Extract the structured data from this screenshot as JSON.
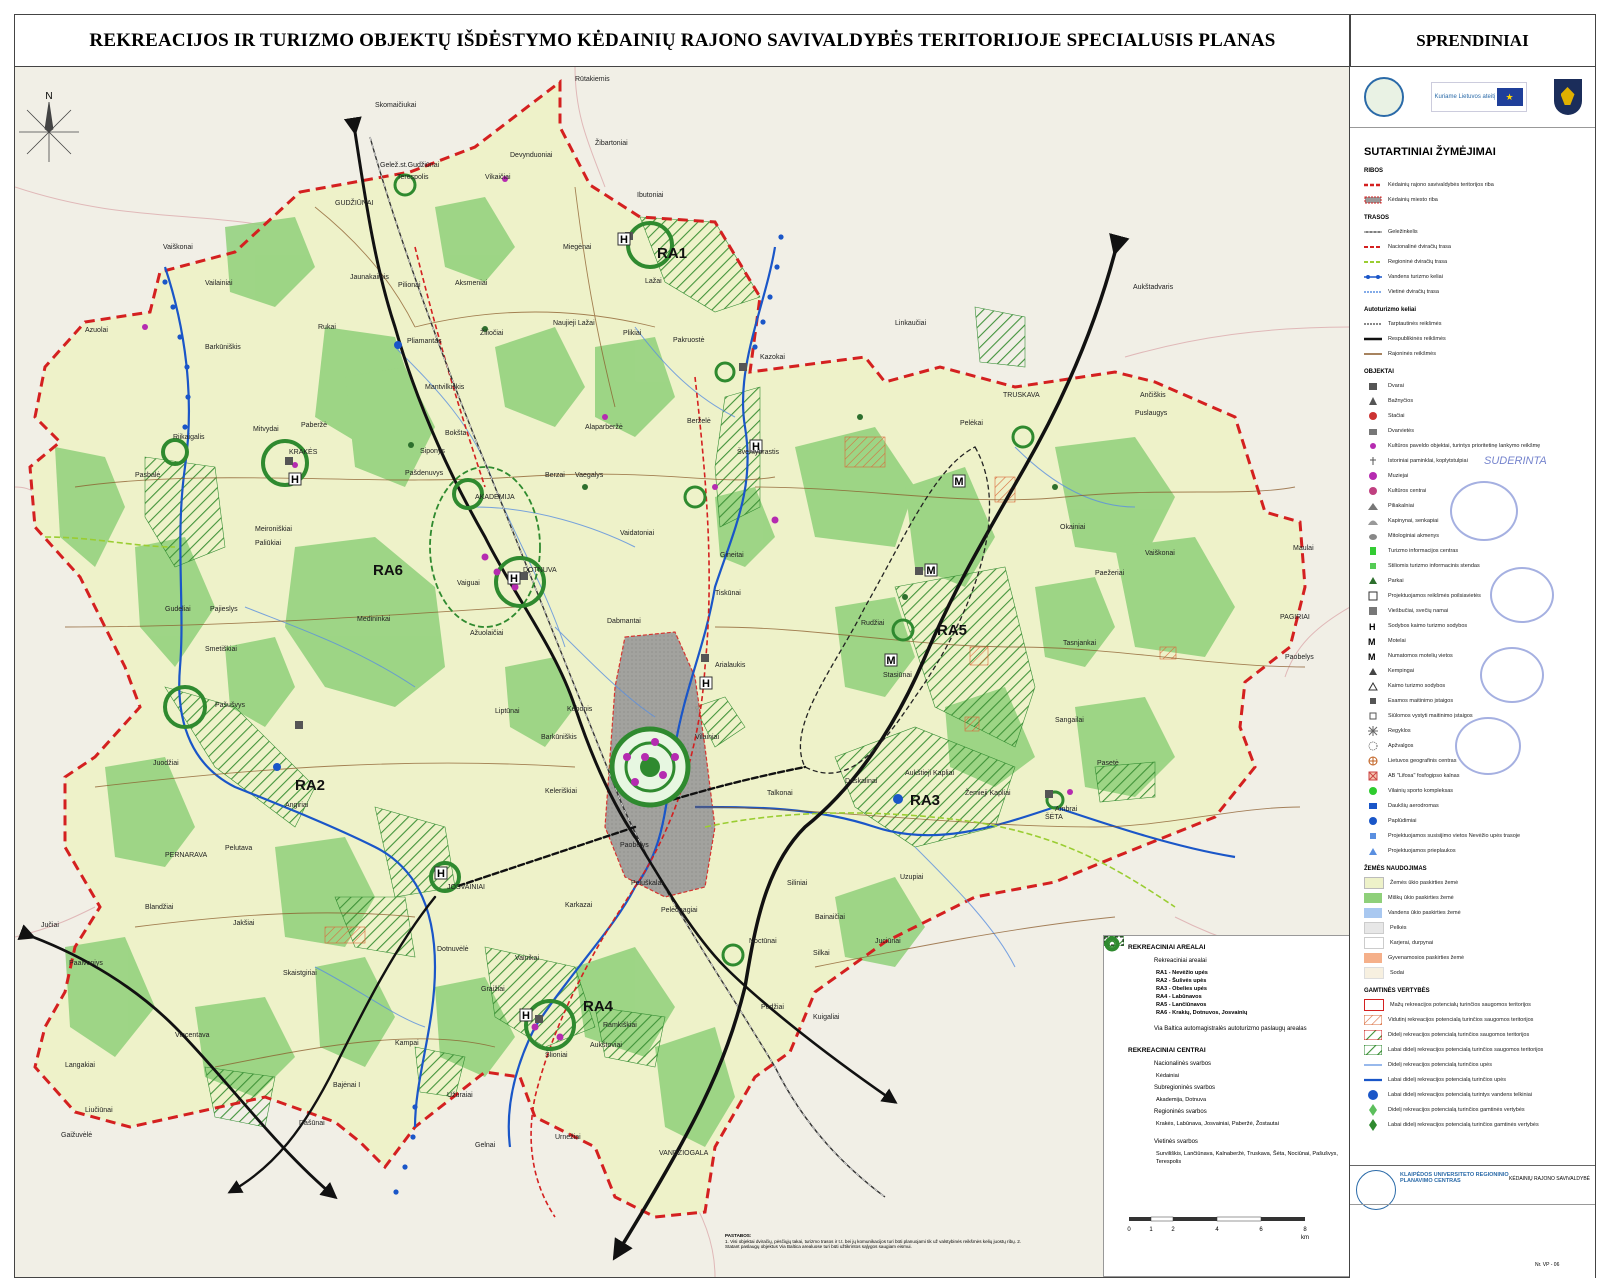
{
  "title": "REKREACIJOS IR TURIZMO OBJEKTŲ IŠDĖSTYMO KĖDAINIŲ RAJONO SAVIVALDYBĖS TERITORIJOJE SPECIALUSIS PLANAS",
  "section_title": "SPRENDINIAI",
  "north_label": "N",
  "area_labels": [
    {
      "id": "RA1",
      "label": "RA1"
    },
    {
      "id": "RA2",
      "label": "RA2"
    },
    {
      "id": "RA3",
      "label": "RA3"
    },
    {
      "id": "RA4",
      "label": "RA4"
    },
    {
      "id": "RA5",
      "label": "RA5"
    },
    {
      "id": "RA6",
      "label": "RA6"
    }
  ],
  "places": [
    "Rūtakiemis",
    "Skomaičiukai",
    "Žibartoniai",
    "Gelež.st.Gudžiūnai",
    "Terespolis",
    "Devynduoniai",
    "Vikaičiai",
    "GUDŽIŪNAI",
    "Ibutoniai",
    "Miegėnai",
    "Vaiškonai",
    "Vailainiai",
    "Jaunakaimis",
    "Pilionai",
    "Aksmeniai",
    "Lažai",
    "Aukštadvaris",
    "Rukai",
    "Žiliočiai",
    "Naujieji Lažai",
    "Plikiai",
    "Linkaučiai",
    "Azuolai",
    "Pliamantas",
    "Barkūniškis",
    "Pakruostė",
    "Kazokai",
    "Mantvilkiškis",
    "Ančiškis",
    "Pelėkai",
    "TRUSKAVA",
    "Riikaigalis",
    "Mitvydai",
    "Paberžė",
    "Bokšta",
    "Alaparberžė",
    "Berželė",
    "Šventybrastis",
    "Puslaugys",
    "Pasbalė",
    "KRAKĖS",
    "Siponys",
    "Pašdenuvys",
    "Berzai",
    "Vaegalys",
    "AKADEMIJA",
    "Meironiškiai",
    "Paliūkiai",
    "Vaidatoniai",
    "Gineitai",
    "Okainiai",
    "Vaiškonai",
    "DOTNUVA",
    "Vaiguai",
    "Maulai",
    "RA6",
    "Gudeliai",
    "Pajieslys",
    "Medininkai",
    "Rudžiai",
    "Paežeriai",
    "PAGIRIAI",
    "Paobelys",
    "Tiskūnai",
    "Smetiškiai",
    "Ažuolaičiai",
    "Dabmantai",
    "Tasnjankai",
    "Arialaukis",
    "Pašušvys",
    "Stasiūnai",
    "Liptūnai",
    "Kebonis",
    "Barkūniškis",
    "Vilainiai",
    "Sangailai",
    "Juodžiai",
    "Daskalinai",
    "Aukštieji Kapliai",
    "Žemieji Kapliai",
    "Pasetė",
    "ŠĖTA",
    "Ambrai",
    "Angiriai",
    "Talkonai",
    "Keleriškiai",
    "PERNARAVA",
    "Paobelys",
    "Peluškalai",
    "Pelutava",
    "JOSVAINIAI",
    "Blandžiai",
    "Jakšiai",
    "Pelėdnagiai",
    "Uzupiai",
    "Jučiai",
    "Karkazai",
    "Dotnuvėlė",
    "Siliniai",
    "Bainaičiai",
    "Juciūnai",
    "Paalvoniys",
    "Graižiai",
    "Vainikai",
    "Noctūnai",
    "Silkai",
    "Vincentava",
    "Skaistgiriai",
    "Pedžiai",
    "Kuigaliai",
    "Langakiai",
    "Kampai",
    "Šlioniai",
    "Ramkiškiai",
    "Bajėnai I",
    "Labūnava",
    "Aukštoviai",
    "Liučiūnai",
    "Gaižuvėlė",
    "Dašūnai",
    "Užuraiai",
    "Urnėžiai",
    "Gelnai",
    "VANDŽIOGALA"
  ],
  "legend": {
    "heading": "SUTARTINIAI ŽYMĖJIMAI",
    "ribos_title": "RIBOS",
    "ribos": [
      "Kėdainių rajono savivaldybės teritorijos riba",
      "Kėdainių miesto riba"
    ],
    "trasos_title": "TRASOS",
    "trasos": [
      "Geležinkelis",
      "Nacionalinė dviračių trasa",
      "Regioninė dviračių trasa",
      "Vandens turizmo keliai",
      "Vietinė dviračių trasa"
    ],
    "auto_title": "Autoturizmo keliai",
    "auto": [
      "Tarptautinės reikšmės",
      "Respublikinės reikšmės",
      "Rajoninės reikšmės"
    ],
    "objektai_title": "OBJEKTAI",
    "objektai": [
      "Dvarai",
      "Bažnyčios",
      "Stačiai",
      "Dvarvietės",
      "Kultūros paveldo objektai, turintys prioritetinę lankymo reikšmę",
      "Istoriniai paminklai, koplytstulpiai",
      "Muziejai",
      "Kultūros centrai",
      "Piliakalniai",
      "Kapinynai, senkapiai",
      "Mitologiniai akmenys",
      "Turizmo informacijos centras",
      "Stiliomis turizmo informacinis stendas",
      "Parkai",
      "Projektuojamos reikšmės poilsiavietės",
      "Viešbučiai, svečių namai",
      "Sodybos kaimo turizmo sodybos",
      "Motelai",
      "Numatomos motelių vietos",
      "Kempingai",
      "Kaimo turizmo sodybos",
      "Esamos maitinimo įstaigos",
      "Siūlomos vystyti maitinimo įstaigos",
      "Regyklos",
      "Apžvalgos",
      "Lietuvos geografinis centras",
      "AB \"Lifosa\" fosfogipso kalnas",
      "Vilainių sporto kompleksas",
      "Daukšių aerodromas",
      "Paplūdimiai",
      "Projektuojamos susisijimo vietos Nevėžio upės trasoje",
      "Projektuojamos prieplaukos"
    ],
    "zemes_title": "ŽEMĖS NAUDOJIMAS",
    "zemes": [
      "Žemės ūkio paskirties žemė",
      "Miškų ūkio paskirties žemė",
      "Vandens ūkio paskirties žemė",
      "Pelkės",
      "Karjerai, durpynai",
      "Gyvenamosios paskirties žemė",
      "Sodai"
    ],
    "gamtines_title": "GAMTINĖS VERTYBĖS",
    "gamtines": [
      "Mažų rekreacijos potencialų turinčios saugomos teritorijos",
      "Vidutinį rekreacijos potencialą turinčios saugomos teritorijos",
      "Didelį rekreacijos potencialą turinčios saugomos teritorijos",
      "Labai didelį rekreacijos potencialą turinčios saugomos teritorijos",
      "Didelį rekreacijos potencialą turinčios upės",
      "Labai didelį rekreacijos potencialą turinčios upės",
      "Labai didelį rekreacijos potencialą turintys vandens telkiniai",
      "Didelį rekreacijos potencialą turinčios gamtinės vertybės",
      "Labai didelį rekreacijos potencialą turinčios gamtinės vertybės"
    ],
    "stamp_text": "SUDERINTA"
  },
  "map_legend": {
    "areas_title": "REKREACINIAI AREALAI",
    "areas_item": "Rekreaciniai arealai",
    "areas_list": [
      "RA1 - Nevėžio upės",
      "RA2 - Šušvės upės",
      "RA3 - Obelies upės",
      "RA4 - Labūnavos",
      "RA5 - Lančiūnavos",
      "RA6 - Krakių, Dotnuvos, Josvainių"
    ],
    "via_baltica": "Via Baltica automagistralės autoturizmo paslaugų arealas",
    "centers_title": "REKREACINIAI CENTRAI",
    "national": "Nacionalinės svarbos",
    "national_sub": "Kėdainiai",
    "subregional": "Subregioninės svarbos",
    "subregional_sub": "Akademija, Dotnuva",
    "regional": "Regioninės svarbos",
    "regional_sub": "Krakės, Labūnava, Josvainiai, Paberžė, Žostautai",
    "local": "Vietinės svarbos",
    "local_sub": "Surviliškis, Lančiūnava, Kalnaberžė, Truskava, Šėta, Nociūnai, Pašušvys, Terespolis"
  },
  "scale_labels": [
    "0",
    "1",
    "2",
    "4",
    "6",
    "8"
  ],
  "scale_unit": "km",
  "notes_title": "PASTABOS:",
  "notes": "1. Visi objektai dviračių, pėsčiųjų takai, turizmo trasos ir t.t. bei jų komunikacijos turi būti planuojami tik už valstybinės reikšmės kelių juostų ribų. 2. Statant paslaugų objektus Via Baltica arealuose turi būti užtikrintos sąlygos saugiam eismui.",
  "title_block": {
    "org": "KLAIPĖDOS UNIVERSITETO REGIONINIO PLANAVIMO CENTRAS",
    "project": "KĖDAINIŲ RAJONO SAVIVALDYBĖ",
    "sheet": "Nr. VP - 06"
  },
  "colors": {
    "boundary": "#d42020",
    "forest": "#8fd07a",
    "farmland": "#eef2c9",
    "river": "#1a56c8",
    "road_main": "#111111",
    "recreation_hatch": "#2f8a2f",
    "city": "#8e8e8e"
  }
}
